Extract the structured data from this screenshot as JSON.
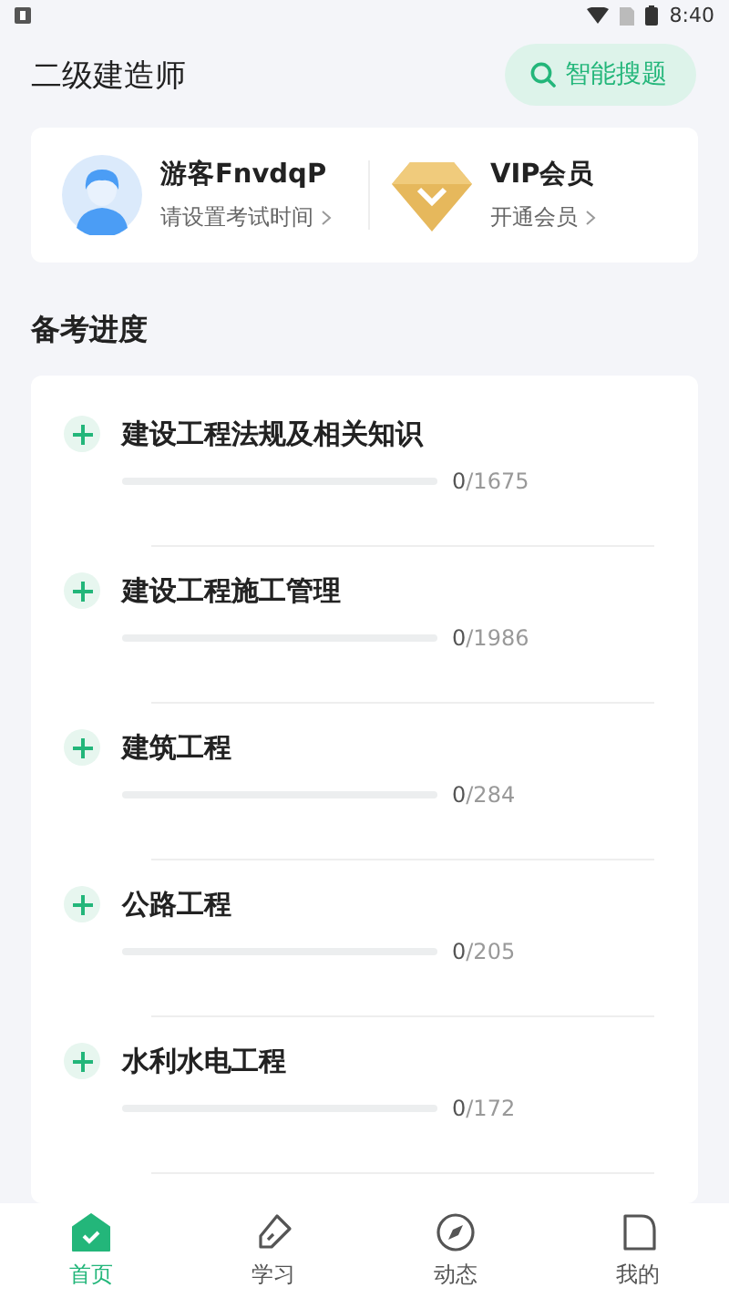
{
  "status_bar": {
    "time": "8:40"
  },
  "header": {
    "title": "二级建造师",
    "search_button": "智能搜题"
  },
  "user_card": {
    "name": "游客FnvdqP",
    "hint": "请设置考试时间",
    "vip_title": "VIP会员",
    "vip_link": "开通会员"
  },
  "progress": {
    "title": "备考进度",
    "subjects": [
      {
        "name": "建设工程法规及相关知识",
        "level": 0,
        "done": "0",
        "total": "/1675"
      },
      {
        "name": "建设工程施工管理",
        "level": 0,
        "done": "0",
        "total": "/1986"
      },
      {
        "name": "建筑工程",
        "level": 0,
        "done": "0",
        "total": "/284"
      },
      {
        "name": "公路工程",
        "level": 0,
        "done": "0",
        "total": "/205"
      },
      {
        "name": "水利水电工程",
        "level": 0,
        "done": "0",
        "total": "/172"
      }
    ]
  },
  "tabs": [
    {
      "kind": "home",
      "label": "首页",
      "selected": true
    },
    {
      "kind": "study",
      "label": "学习",
      "selected": false
    },
    {
      "kind": "feed",
      "label": "动态",
      "selected": false
    },
    {
      "kind": "mine",
      "label": "我的",
      "selected": false
    }
  ]
}
